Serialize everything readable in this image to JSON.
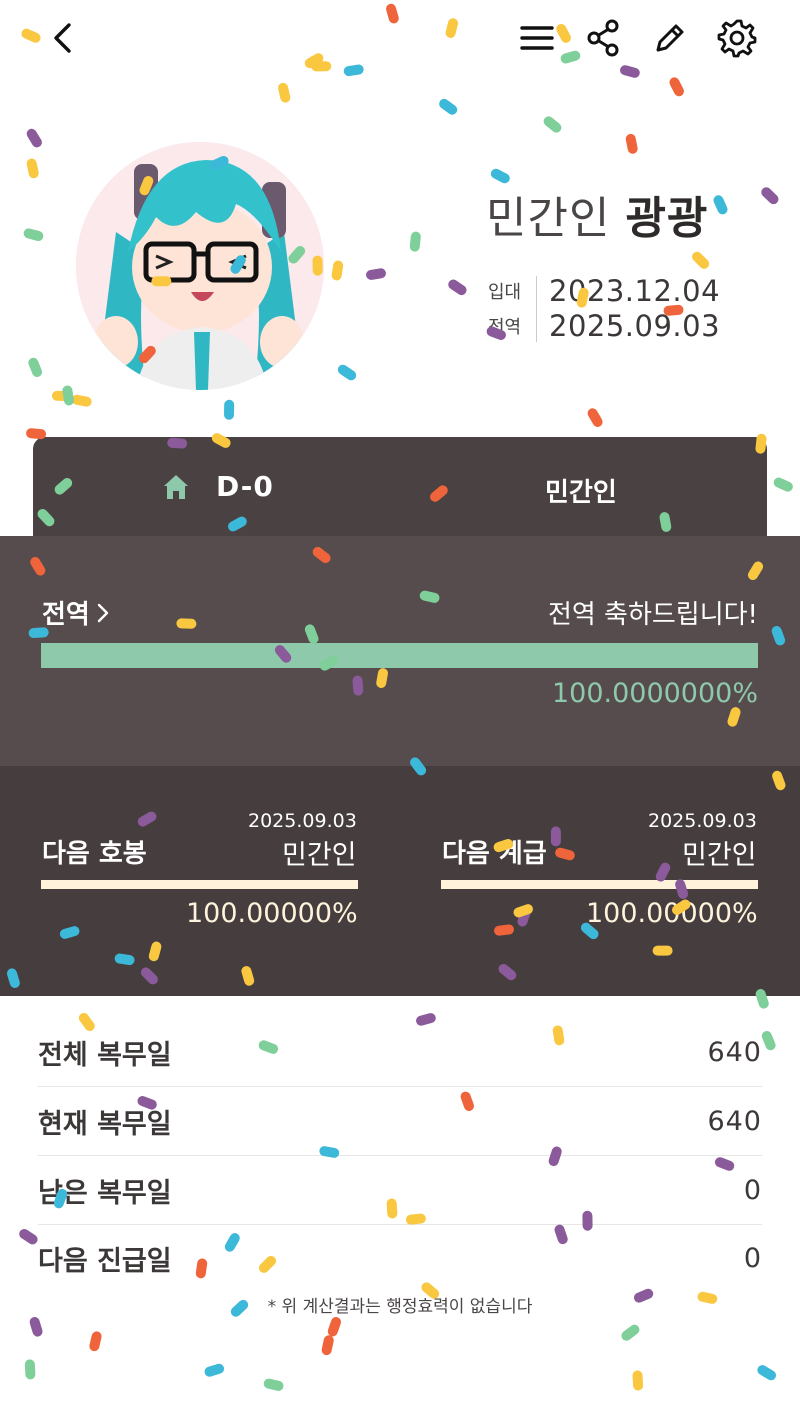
{
  "toolbar": {
    "back_icon": "chevron-left-icon",
    "menu_icon": "hamburger-menu-icon",
    "share_icon": "share-icon",
    "edit_icon": "pencil-icon",
    "settings_icon": "gear-icon"
  },
  "profile": {
    "name_prefix": "민간인",
    "name_main": "광광",
    "enlist_label": "입대",
    "enlist_date": "2023.12.04",
    "discharge_label": "전역",
    "discharge_date": "2025.09.03"
  },
  "status": {
    "home_icon": "home-icon",
    "dday": "D-0",
    "rank": "민간인"
  },
  "service": {
    "title": "전역",
    "message": "전역 축하드립니다!",
    "progress": 100,
    "progress_text": "100.0000000%"
  },
  "next_step": {
    "title": "다음 호봉",
    "date": "2025.09.03",
    "status": "민간인",
    "progress": 100,
    "progress_text": "100.00000%"
  },
  "next_rank": {
    "title": "다음 계급",
    "date": "2025.09.03",
    "status": "민간인",
    "progress": 100,
    "progress_text": "100.00000%"
  },
  "stats": [
    {
      "label": "전체 복무일",
      "value": "640"
    },
    {
      "label": "현재 복무일",
      "value": "640"
    },
    {
      "label": "남은 복무일",
      "value": "0"
    },
    {
      "label": "다음 진급일",
      "value": "0"
    }
  ],
  "footnote": "* 위 계산결과는 행정효력이 없습니다",
  "colors": {
    "accent_green": "#8ec9ab",
    "cream": "#fff3db",
    "panel_dark": "#463d3e",
    "panel_mid": "#564c4d"
  }
}
